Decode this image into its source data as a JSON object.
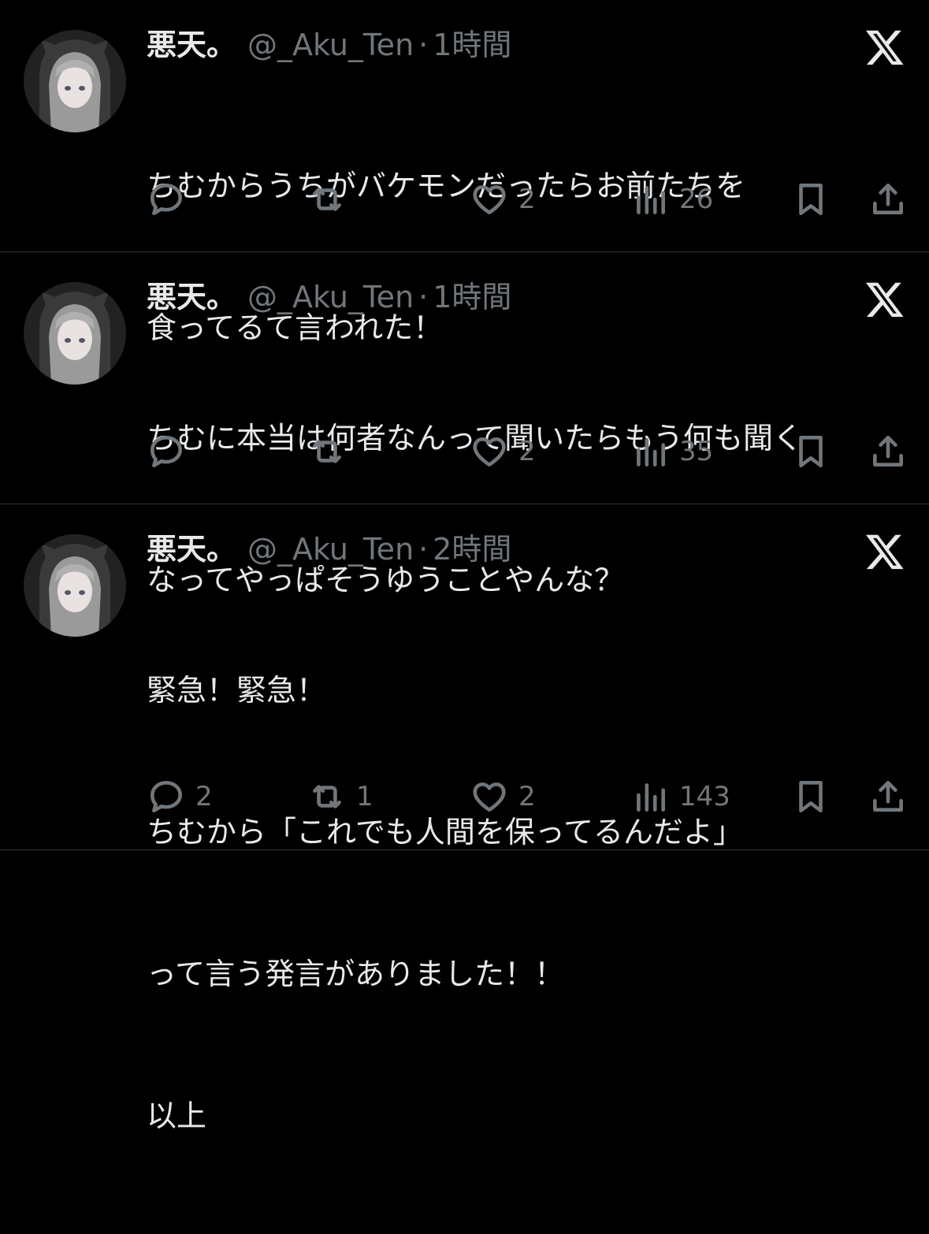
{
  "tweets": [
    {
      "name": "悪天。",
      "handle": "@_Aku_Ten",
      "separator": "·",
      "time": "1時間",
      "lines": [
        "ちむからうちがバケモンだったらお前たちを",
        "食ってるて言われた！"
      ],
      "reply_count": "",
      "repost_count": "",
      "like_count": "2",
      "view_count": "26"
    },
    {
      "name": "悪天。",
      "handle": "@_Aku_Ten",
      "separator": "·",
      "time": "1時間",
      "lines": [
        "ちむに本当は何者なんって聞いたらもう何も聞く",
        "なってやっぱそうゆうことやんな？"
      ],
      "reply_count": "",
      "repost_count": "",
      "like_count": "2",
      "view_count": "35"
    },
    {
      "name": "悪天。",
      "handle": "@_Aku_Ten",
      "separator": "·",
      "time": "2時間",
      "lines": [
        "緊急！緊急！",
        "ちむから「これでも人間を保ってるんだよ」",
        "って言う発言がありました！！",
        "以上"
      ],
      "reply_count": "2",
      "repost_count": "1",
      "like_count": "2",
      "view_count": "143"
    }
  ],
  "icons": {
    "reply": "speech-bubble-icon",
    "repost": "repost-arrows-icon",
    "like": "heart-icon",
    "views": "bar-chart-icon",
    "bookmark": "bookmark-icon",
    "share": "share-upload-icon",
    "platform": "x-logo-icon"
  },
  "colors": {
    "background": "#000000",
    "text": "#e7e9ea",
    "secondary": "#71767b",
    "divider": "#2f3336"
  }
}
